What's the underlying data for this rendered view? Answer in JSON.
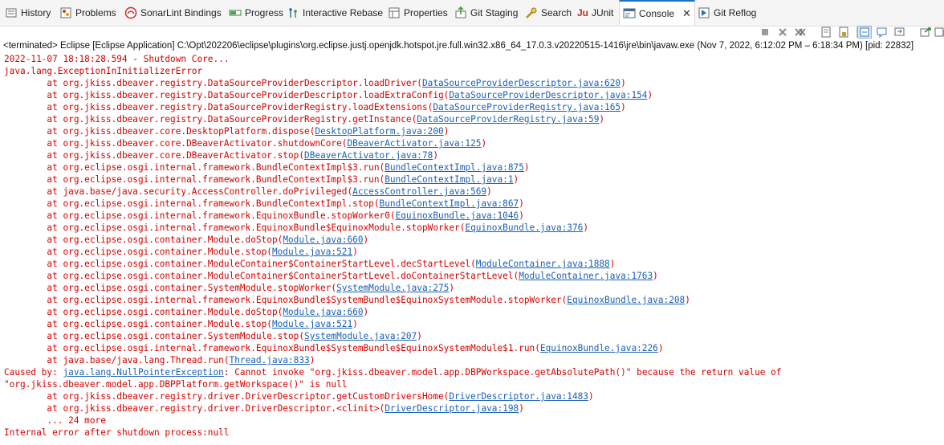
{
  "tabs": [
    {
      "label": "History",
      "icon": "history-icon"
    },
    {
      "label": "Problems",
      "icon": "problems-icon"
    },
    {
      "label": "SonarLint Bindings",
      "icon": "sonarlint-icon"
    },
    {
      "label": "Progress",
      "icon": "progress-icon"
    },
    {
      "label": "Interactive Rebase",
      "icon": "rebase-icon"
    },
    {
      "label": "Properties",
      "icon": "properties-icon"
    },
    {
      "label": "Git Staging",
      "icon": "git-staging-icon"
    },
    {
      "label": "Search",
      "icon": "search-icon"
    },
    {
      "label": "JUnit",
      "icon": "junit-icon",
      "prefix": "Ju"
    },
    {
      "label": "Console",
      "icon": "console-icon",
      "active": true
    },
    {
      "label": "Git Reflog",
      "icon": "git-reflog-icon"
    }
  ],
  "console_header": "<terminated> Eclipse [Eclipse Application] C:\\Opt\\202206\\eclipse\\plugins\\org.eclipse.justj.openjdk.hotspot.jre.full.win32.x86_64_17.0.3.v20220515-1416\\jre\\bin\\javaw.exe  (Nov 7, 2022, 6:12:02 PM – 6:18:34 PM) [pid: 22832]",
  "colors": {
    "error_text": "#d40000",
    "link": "#1a5fb4",
    "active_tab_border": "#1a73c8"
  },
  "lines": {
    "l0": "2022-11-07 18:18:28.594 - Shutdown Core...",
    "l1": "java.lang.ExceptionInInitializerError",
    "l2_pre": "\tat org.jkiss.dbeaver.registry.DataSourceProviderDescriptor.loadDriver(",
    "l2_link": "DataSourceProviderDescriptor.java:620",
    "l2_post": ")",
    "l3_pre": "\tat org.jkiss.dbeaver.registry.DataSourceProviderDescriptor.loadExtraConfig(",
    "l3_link": "DataSourceProviderDescriptor.java:154",
    "l3_post": ")",
    "l4_pre": "\tat org.jkiss.dbeaver.registry.DataSourceProviderRegistry.loadExtensions(",
    "l4_link": "DataSourceProviderRegistry.java:165",
    "l4_post": ")",
    "l5_pre": "\tat org.jkiss.dbeaver.registry.DataSourceProviderRegistry.getInstance(",
    "l5_link": "DataSourceProviderRegistry.java:59",
    "l5_post": ")",
    "l6_pre": "\tat org.jkiss.dbeaver.core.DesktopPlatform.dispose(",
    "l6_link": "DesktopPlatform.java:200",
    "l6_post": ")",
    "l7_pre": "\tat org.jkiss.dbeaver.core.DBeaverActivator.shutdownCore(",
    "l7_link": "DBeaverActivator.java:125",
    "l7_post": ")",
    "l8_pre": "\tat org.jkiss.dbeaver.core.DBeaverActivator.stop(",
    "l8_link": "DBeaverActivator.java:78",
    "l8_post": ")",
    "l9_pre": "\tat org.eclipse.osgi.internal.framework.BundleContextImpl$3.run(",
    "l9_link": "BundleContextImpl.java:875",
    "l9_post": ")",
    "l10_pre": "\tat org.eclipse.osgi.internal.framework.BundleContextImpl$3.run(",
    "l10_link": "BundleContextImpl.java:1",
    "l10_post": ")",
    "l11_pre": "\tat java.base/java.security.AccessController.doPrivileged(",
    "l11_link": "AccessController.java:569",
    "l11_post": ")",
    "l12_pre": "\tat org.eclipse.osgi.internal.framework.BundleContextImpl.stop(",
    "l12_link": "BundleContextImpl.java:867",
    "l12_post": ")",
    "l13_pre": "\tat org.eclipse.osgi.internal.framework.EquinoxBundle.stopWorker0(",
    "l13_link": "EquinoxBundle.java:1046",
    "l13_post": ")",
    "l14_pre": "\tat org.eclipse.osgi.internal.framework.EquinoxBundle$EquinoxModule.stopWorker(",
    "l14_link": "EquinoxBundle.java:376",
    "l14_post": ")",
    "l15_pre": "\tat org.eclipse.osgi.container.Module.doStop(",
    "l15_link": "Module.java:660",
    "l15_post": ")",
    "l16_pre": "\tat org.eclipse.osgi.container.Module.stop(",
    "l16_link": "Module.java:521",
    "l16_post": ")",
    "l17_pre": "\tat org.eclipse.osgi.container.ModuleContainer$ContainerStartLevel.decStartLevel(",
    "l17_link": "ModuleContainer.java:1888",
    "l17_post": ")",
    "l18_pre": "\tat org.eclipse.osgi.container.ModuleContainer$ContainerStartLevel.doContainerStartLevel(",
    "l18_link": "ModuleContainer.java:1763",
    "l18_post": ")",
    "l19_pre": "\tat org.eclipse.osgi.container.SystemModule.stopWorker(",
    "l19_link": "SystemModule.java:275",
    "l19_post": ")",
    "l20_pre": "\tat org.eclipse.osgi.internal.framework.EquinoxBundle$SystemBundle$EquinoxSystemModule.stopWorker(",
    "l20_link": "EquinoxBundle.java:208",
    "l20_post": ")",
    "l21_pre": "\tat org.eclipse.osgi.container.Module.doStop(",
    "l21_link": "Module.java:660",
    "l21_post": ")",
    "l22_pre": "\tat org.eclipse.osgi.container.Module.stop(",
    "l22_link": "Module.java:521",
    "l22_post": ")",
    "l23_pre": "\tat org.eclipse.osgi.container.SystemModule.stop(",
    "l23_link": "SystemModule.java:207",
    "l23_post": ")",
    "l24_pre": "\tat org.eclipse.osgi.internal.framework.EquinoxBundle$SystemBundle$EquinoxSystemModule$1.run(",
    "l24_link": "EquinoxBundle.java:226",
    "l24_post": ")",
    "l25_pre": "\tat java.base/java.lang.Thread.run(",
    "l25_link": "Thread.java:833",
    "l25_post": ")",
    "l26_pre": "Caused by: ",
    "l26_link": "java.lang.NullPointerException",
    "l26_post": ": Cannot invoke \"org.jkiss.dbeaver.model.app.DBPWorkspace.getAbsolutePath()\" because the return value of",
    "l27": "\"org.jkiss.dbeaver.model.app.DBPPlatform.getWorkspace()\" is null",
    "l28_pre": "\tat org.jkiss.dbeaver.registry.driver.DriverDescriptor.getCustomDriversHome(",
    "l28_link": "DriverDescriptor.java:1483",
    "l28_post": ")",
    "l29_pre": "\tat org.jkiss.dbeaver.registry.driver.DriverDescriptor.<clinit>(",
    "l29_link": "DriverDescriptor.java:198",
    "l29_post": ")",
    "l30": "\t... 24 more",
    "l31": "Internal error after shutdown process:null"
  }
}
